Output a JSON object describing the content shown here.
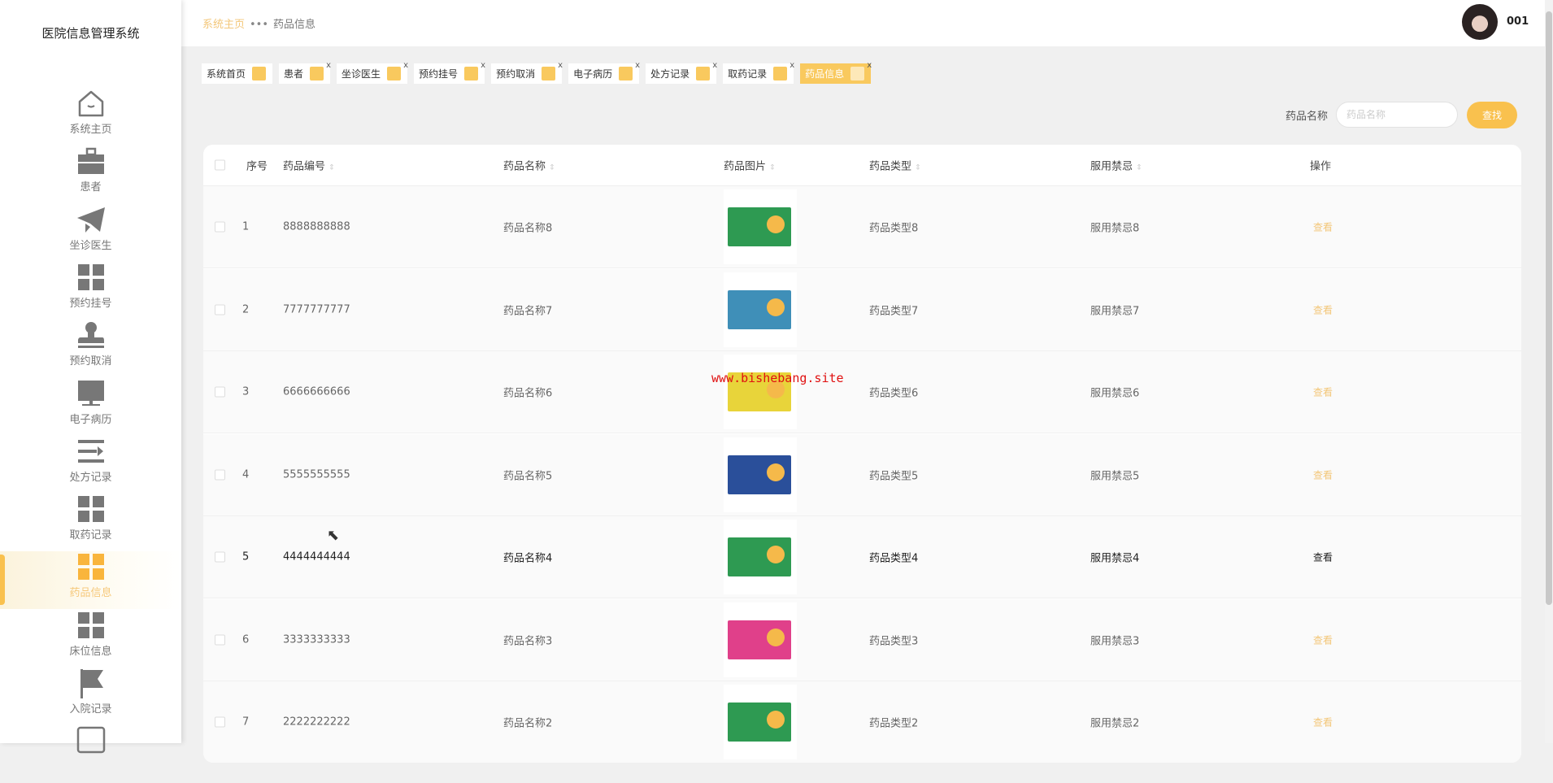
{
  "app_title": "医院信息管理系统",
  "sidebar": {
    "items": [
      {
        "label": "系统主页",
        "icon": "home-icon"
      },
      {
        "label": "患者",
        "icon": "briefcase-icon"
      },
      {
        "label": "坐诊医生",
        "icon": "paper-plane-icon"
      },
      {
        "label": "预约挂号",
        "icon": "grid-icon"
      },
      {
        "label": "预约取消",
        "icon": "stamp-icon"
      },
      {
        "label": "电子病历",
        "icon": "monitor-icon"
      },
      {
        "label": "处方记录",
        "icon": "list-icon"
      },
      {
        "label": "取药记录",
        "icon": "grid-icon"
      },
      {
        "label": "药品信息",
        "icon": "grid-icon",
        "active": true
      },
      {
        "label": "床位信息",
        "icon": "grid-icon"
      },
      {
        "label": "入院记录",
        "icon": "flag-icon"
      },
      {
        "label": "",
        "icon": "box-icon"
      }
    ]
  },
  "header": {
    "breadcrumb_home": "系统主页",
    "breadcrumb_current": "药品信息",
    "username": "001"
  },
  "tabs": [
    {
      "label": "系统首页",
      "closable": false
    },
    {
      "label": "患者",
      "closable": true
    },
    {
      "label": "坐诊医生",
      "closable": true
    },
    {
      "label": "预约挂号",
      "closable": true
    },
    {
      "label": "预约取消",
      "closable": true
    },
    {
      "label": "电子病历",
      "closable": true
    },
    {
      "label": "处方记录",
      "closable": true
    },
    {
      "label": "取药记录",
      "closable": true
    },
    {
      "label": "药品信息",
      "closable": true,
      "active": true
    }
  ],
  "tab_close": "x",
  "search": {
    "label": "药品名称",
    "placeholder": "药品名称",
    "button": "查找"
  },
  "table": {
    "columns": [
      "序号",
      "药品编号",
      "药品名称",
      "药品图片",
      "药品类型",
      "服用禁忌",
      "操作"
    ],
    "sort_icon": "⇕",
    "action_label": "查看",
    "rows": [
      {
        "index": "1",
        "code": "8888888888",
        "name": "药品名称8",
        "type": "药品类型8",
        "taboo": "服用禁忌8",
        "img": "#2e9a52"
      },
      {
        "index": "2",
        "code": "7777777777",
        "name": "药品名称7",
        "type": "药品类型7",
        "taboo": "服用禁忌7",
        "img": "#3f8fb8"
      },
      {
        "index": "3",
        "code": "6666666666",
        "name": "药品名称6",
        "type": "药品类型6",
        "taboo": "服用禁忌6",
        "img": "#e8d43a"
      },
      {
        "index": "4",
        "code": "5555555555",
        "name": "药品名称5",
        "type": "药品类型5",
        "taboo": "服用禁忌5",
        "img": "#2a4f9a"
      },
      {
        "index": "5",
        "code": "4444444444",
        "name": "药品名称4",
        "type": "药品类型4",
        "taboo": "服用禁忌4",
        "img": "#2e9a52",
        "hover": true
      },
      {
        "index": "6",
        "code": "3333333333",
        "name": "药品名称3",
        "type": "药品类型3",
        "taboo": "服用禁忌3",
        "img": "#e0408a"
      },
      {
        "index": "7",
        "code": "2222222222",
        "name": "药品名称2",
        "type": "药品类型2",
        "taboo": "服用禁忌2",
        "img": "#2e9a52"
      }
    ]
  },
  "watermark": "www.bishebang.site",
  "colors": {
    "accent": "#f9c14e",
    "accent_light": "#f3c77a"
  }
}
